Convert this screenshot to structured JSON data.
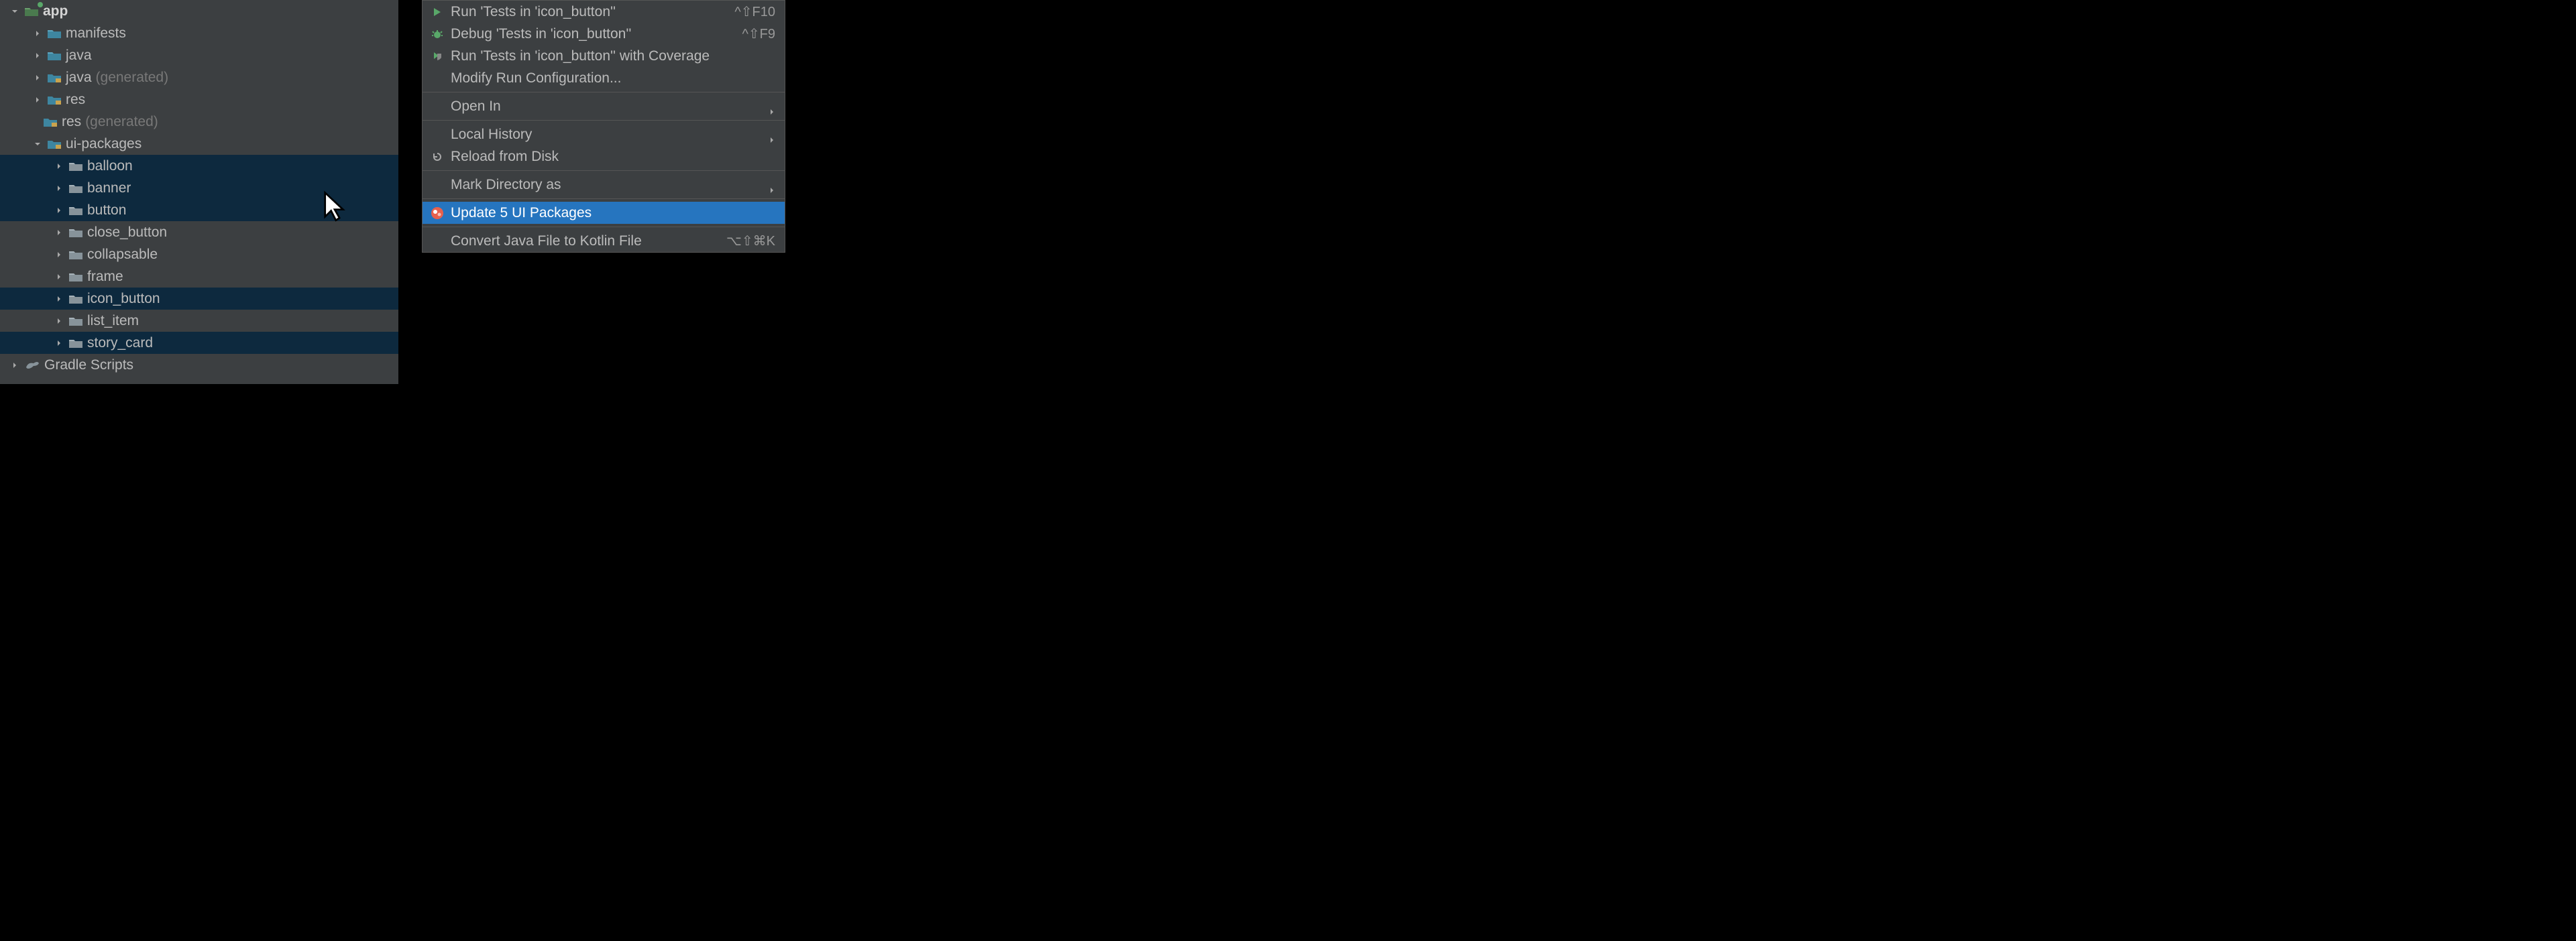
{
  "tree": {
    "app": {
      "label": "app"
    },
    "manifests": {
      "label": "manifests"
    },
    "java": {
      "label": "java"
    },
    "java_gen": {
      "label": "java",
      "suffix": "(generated)"
    },
    "res": {
      "label": "res"
    },
    "res_gen": {
      "label": "res",
      "suffix": "(generated)"
    },
    "ui_packages": {
      "label": "ui-packages"
    },
    "balloon": {
      "label": "balloon"
    },
    "banner": {
      "label": "banner"
    },
    "button": {
      "label": "button"
    },
    "close_button": {
      "label": "close_button"
    },
    "collapsable": {
      "label": "collapsable"
    },
    "frame": {
      "label": "frame"
    },
    "icon_button": {
      "label": "icon_button"
    },
    "list_item": {
      "label": "list_item"
    },
    "story_card": {
      "label": "story_card"
    },
    "gradle": {
      "label": "Gradle Scripts"
    }
  },
  "menu": {
    "run_tests": {
      "label": "Run 'Tests in 'icon_button''",
      "shortcut": "^⇧F10"
    },
    "debug_tests": {
      "label": "Debug 'Tests in 'icon_button''",
      "shortcut": "^⇧F9"
    },
    "coverage": {
      "label": "Run 'Tests in 'icon_button'' with Coverage"
    },
    "modify_run": {
      "label": "Modify Run Configuration..."
    },
    "open_in": {
      "label": "Open In"
    },
    "local_history": {
      "label": "Local History"
    },
    "reload": {
      "label": "Reload from Disk"
    },
    "mark_dir": {
      "label": "Mark Directory as"
    },
    "update_pkgs": {
      "label": "Update 5 UI Packages"
    },
    "convert": {
      "label": "Convert Java File to Kotlin File",
      "shortcut": "⌥⇧⌘K"
    }
  }
}
